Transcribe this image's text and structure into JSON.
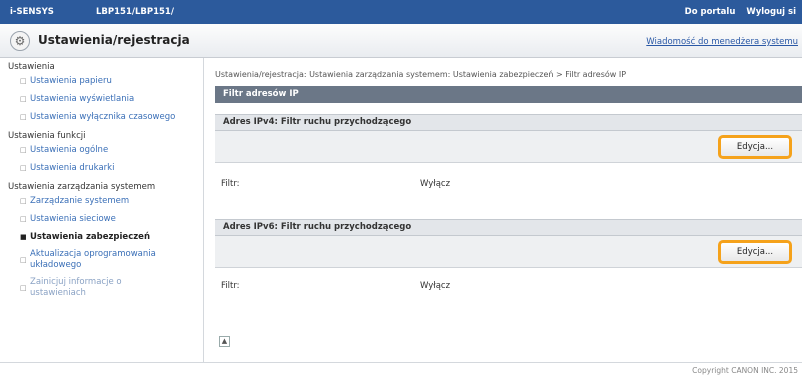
{
  "topbar": {
    "brand": "i-SENSYS",
    "model": "LBP151/LBP151/",
    "portal_link": "Do portalu",
    "logout_link": "Wyloguj si"
  },
  "header": {
    "icon": "settings-circle-icon",
    "title": "Ustawienia/rejestracja",
    "manager_link": "Wiadomość do menedżera systemu"
  },
  "sidebar": {
    "group1": {
      "label": "Ustawienia",
      "items": [
        "Ustawienia papieru",
        "Ustawienia wyświetlania",
        "Ustawienia wyłącznika czasowego"
      ]
    },
    "group2": {
      "label": "Ustawienia funkcji",
      "items": [
        "Ustawienia ogólne",
        "Ustawienia drukarki"
      ]
    },
    "group3": {
      "label": "Ustawienia zarządzania systemem",
      "items": [
        "Zarządzanie systemem",
        "Ustawienia sieciowe",
        "Ustawienia zabezpieczeń"
      ],
      "update_line1": "Aktualizacja oprogramowania",
      "update_line2": "układowego",
      "init_line1": "Zainicjuj informacje o",
      "init_line2": "ustawieniach"
    }
  },
  "main": {
    "breadcrumb": "Ustawienia/rejestracja: Ustawienia zarządzania systemem: Ustawienia zabezpieczeń > Filtr adresów IP",
    "page_title": "Filtr adresów IP",
    "sections": [
      {
        "header": "Adres IPv4: Filtr ruchu przychodzącego",
        "edit_label": "Edycja...",
        "filter_label": "Filtr:",
        "filter_value": "Wyłącz"
      },
      {
        "header": "Adres IPv6: Filtr ruchu przychodzącego",
        "edit_label": "Edycja...",
        "filter_label": "Filtr:",
        "filter_value": "Wyłącz"
      }
    ],
    "scroll_top_icon": "scroll-to-top-icon"
  },
  "footer": {
    "copyright": "Copyright CANON INC. 2015"
  }
}
